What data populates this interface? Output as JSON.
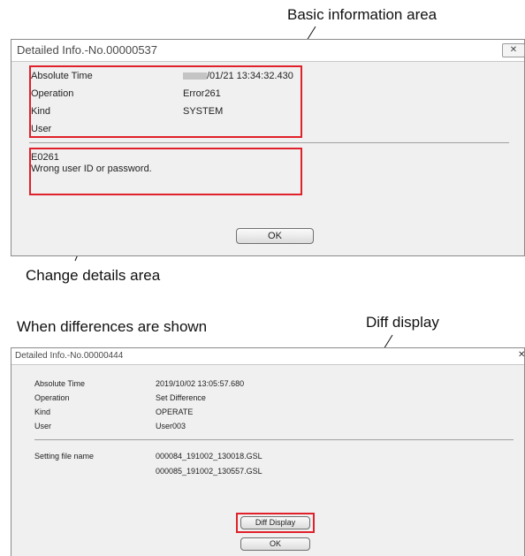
{
  "callouts": {
    "basic_area": "Basic information area",
    "change_area": "Change details area",
    "when_diff": "When differences are shown",
    "diff_display": "Diff display"
  },
  "dialog1": {
    "title": "Detailed Info.-No.00000537",
    "close_glyph": "✕",
    "labels": [
      "Absolute Time",
      "Operation",
      "Kind",
      "User"
    ],
    "values": [
      "/01/21 13:34:32.430",
      "Error261",
      "SYSTEM",
      ""
    ],
    "detail_code": "E0261",
    "detail_message": "Wrong user ID or password.",
    "ok_label": "OK"
  },
  "dialog2": {
    "title": "Detailed Info.-No.00000444",
    "close_glyph": "✕",
    "labels": [
      "Absolute Time",
      "Operation",
      "Kind",
      "User"
    ],
    "values": [
      "2019/10/02 13:05:57.680",
      "Set Difference",
      "OPERATE",
      "User003"
    ],
    "setting_label": "Setting file name",
    "files": [
      "000084_191002_130018.GSL",
      "000085_191002_130557.GSL"
    ],
    "diff_label": "Diff Display",
    "ok_label": "OK"
  },
  "colors": {
    "highlight": "#e0212b",
    "dialog_bg": "#f0f0f0"
  }
}
